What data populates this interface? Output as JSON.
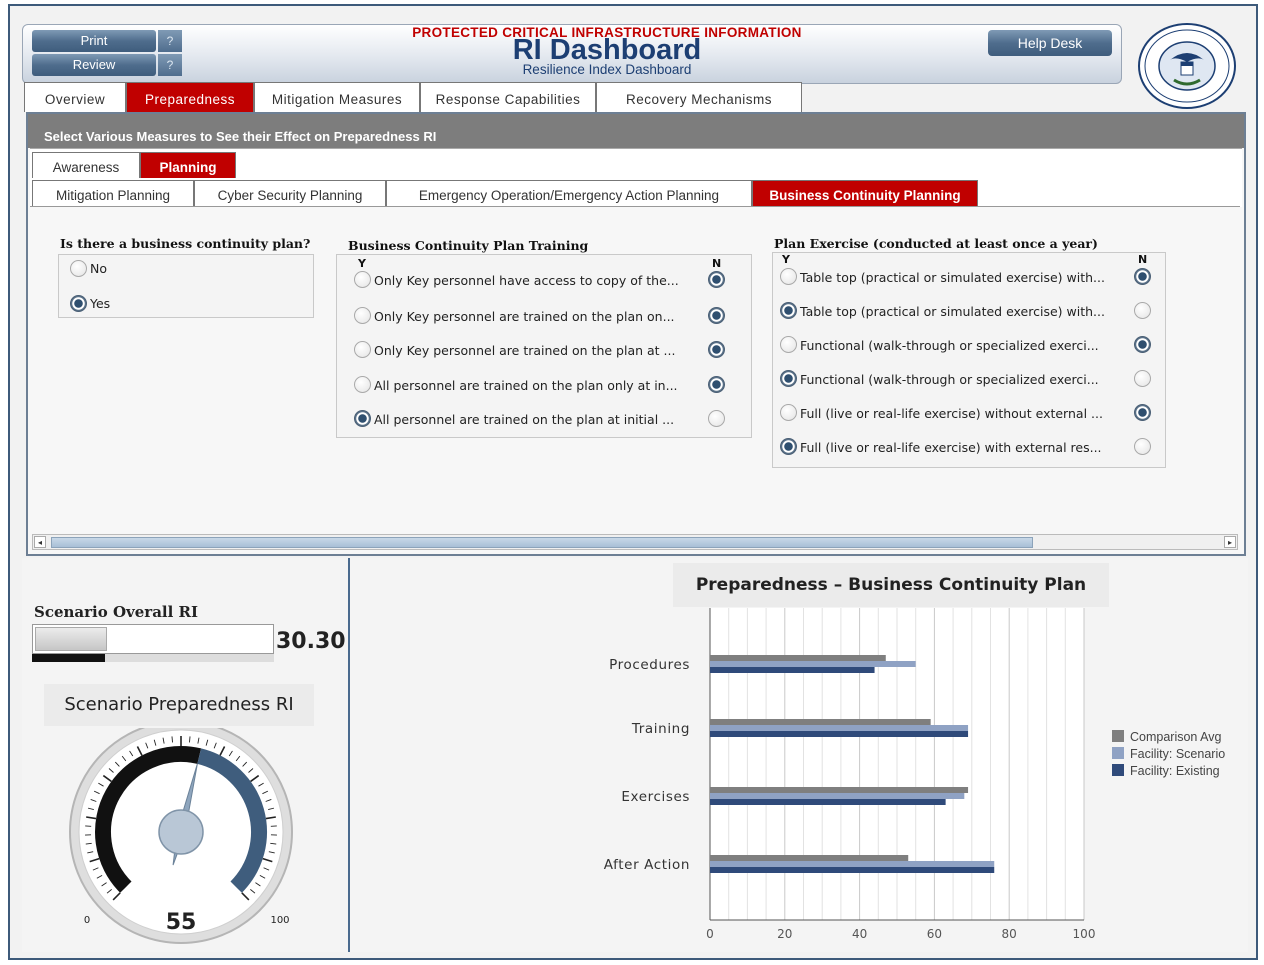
{
  "header": {
    "print_label": "Print",
    "review_label": "Review",
    "help_marker": "?",
    "protected_text": "PROTECTED CRITICAL INFRASTRUCTURE INFORMATION",
    "title": "RI Dashboard",
    "subtitle": "Resilience Index Dashboard",
    "help_desk_label": "Help Desk"
  },
  "main_tabs": [
    "Overview",
    "Preparedness",
    "Mitigation Measures",
    "Response Capabilities",
    "Recovery Mechanisms"
  ],
  "active_main_tab": "Preparedness",
  "select_message": "Select Various Measures to See their Effect on Preparedness RI",
  "sub_tabs": [
    "Awareness",
    "Planning"
  ],
  "active_sub_tab": "Planning",
  "planning_tabs": [
    "Mitigation Planning",
    "Cyber Security Planning",
    "Emergency Operation/Emergency Action Planning",
    "Business Continuity Planning"
  ],
  "active_planning_tab": "Business Continuity Planning",
  "bcp_question": {
    "title": "Is there a business continuity plan?",
    "options": [
      {
        "label": "No",
        "selected": false
      },
      {
        "label": "Yes",
        "selected": true
      }
    ]
  },
  "bcp_training": {
    "title": "Business Continuity Plan Training",
    "y_label": "Y",
    "n_label": "N",
    "options": [
      {
        "label": "Only Key personnel have access to copy of the...",
        "y": false,
        "n": true
      },
      {
        "label": "Only Key personnel are trained on the plan on...",
        "y": false,
        "n": true
      },
      {
        "label": "Only Key personnel are trained on the plan at ...",
        "y": false,
        "n": true
      },
      {
        "label": "All personnel are trained on the plan only at in...",
        "y": false,
        "n": true
      },
      {
        "label": "All personnel are trained on the plan at initial ...",
        "y": true,
        "n": false
      }
    ]
  },
  "plan_exercise": {
    "title": "Plan Exercise (conducted at least once a year)",
    "y_label": "Y",
    "n_label": "N",
    "options": [
      {
        "label": "Table top (practical or simulated exercise) with...",
        "y": false,
        "n": true
      },
      {
        "label": "Table top (practical or simulated exercise) with...",
        "y": true,
        "n": false
      },
      {
        "label": "Functional (walk-through or specialized exerci...",
        "y": false,
        "n": true
      },
      {
        "label": "Functional (walk-through or specialized exerci...",
        "y": true,
        "n": false
      },
      {
        "label": "Full (live or real-life exercise) without external ...",
        "y": false,
        "n": true
      },
      {
        "label": "Full (live or real-life exercise) with external res...",
        "y": true,
        "n": false
      }
    ]
  },
  "scenario_overall": {
    "label": "Scenario Overall RI",
    "value_text": "30.30",
    "value": 30.3
  },
  "preparedness_gauge": {
    "title": "Scenario Preparedness RI",
    "value": 55,
    "value_text": "55",
    "min_label": "0",
    "max_label": "100",
    "min": 0,
    "max": 100
  },
  "colors": {
    "accent_red": "#c00000",
    "comparison": "#7f7f7f",
    "scenario": "#8fa2c4",
    "existing": "#2f4a7a"
  },
  "chart_data": {
    "type": "bar",
    "orientation": "horizontal",
    "title": "Preparedness –  Business Continuity Plan",
    "categories": [
      "Procedures",
      "Training",
      "Exercises",
      "After Action"
    ],
    "series": [
      {
        "name": "Comparison Avg",
        "values": [
          47,
          59,
          69,
          53
        ]
      },
      {
        "name": "Facility: Scenario",
        "values": [
          55,
          69,
          68,
          76
        ]
      },
      {
        "name": "Facility: Existing",
        "values": [
          44,
          69,
          63,
          76
        ]
      }
    ],
    "x_ticks": [
      "0",
      "20",
      "40",
      "60",
      "80",
      "100"
    ],
    "xlim": [
      0,
      100
    ],
    "grid": true,
    "legend_position": "right"
  }
}
